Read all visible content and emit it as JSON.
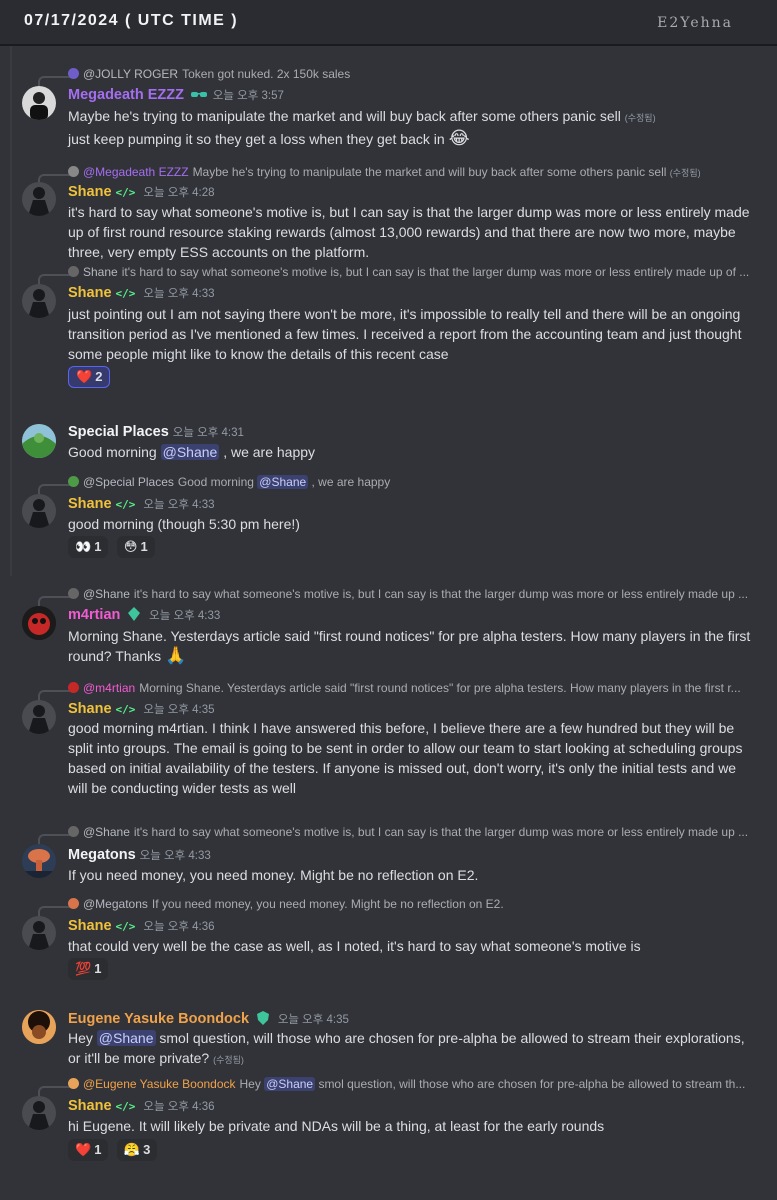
{
  "header": {
    "date": "07/17/2024 ( UTC TIME )",
    "brand": "E2Yehna"
  },
  "colors": {
    "megadeath": "#a46ef0",
    "shane": "#f0c23b",
    "special": "#f2f3f5",
    "m4rtian": "#f25bd2",
    "megatons": "#f2f3f5",
    "eugene": "#f0a24a"
  },
  "messages": [
    {
      "reply": {
        "name": "@JOLLY ROGER",
        "text": "Token got nuked. 2x 150k sales"
      },
      "author": "Megadeath EZZZ",
      "time": "오늘 오후 3:57",
      "lines": [
        "Maybe he's trying to manipulate the market and will buy back after some others panic sell",
        "just keep pumping it so they get a loss when they get back in"
      ],
      "edited": "(수정됨)",
      "emoji": "😂"
    },
    {
      "reply": {
        "name": "@Megadeath EZZZ",
        "text": "Maybe he's trying to manipulate the market and will buy back after some others panic sell",
        "edited": "(수정됨)"
      },
      "author": "Shane",
      "tag": "</>",
      "time": "오늘 오후 4:28",
      "text": "it's hard to say what someone's motive is, but I can say is that the larger dump was more or less entirely made up of first round resource staking rewards (almost 13,000 rewards) and that there are now two more, maybe three, very empty ESS accounts on the platform."
    },
    {
      "reply": {
        "name": "Shane",
        "text": "it's hard to say what someone's motive is, but I can say is that the larger dump was more or less entirely made up of ..."
      },
      "author": "Shane",
      "tag": "</>",
      "time": "오늘 오후 4:33",
      "text": "just pointing out I am not saying there won't be more, it's impossible to really tell and there will be an ongoing transition period as I've mentioned a few times. I received a report from the accounting team and just thought some people might like to know the details of this recent case",
      "reactions": [
        {
          "emoji": "❤️",
          "count": "2"
        }
      ]
    },
    {
      "author": "Special Places",
      "time": "오늘 오후 4:31",
      "pre": "Good morning",
      "mention": "@Shane",
      "post": ", we are happy"
    },
    {
      "reply": {
        "name": "@Special Places",
        "text_pre": "Good morning",
        "mention": "@Shane",
        "text_post": ", we are happy"
      },
      "author": "Shane",
      "tag": "</>",
      "time": "오늘 오후 4:33",
      "text": "good morning (though 5:30 pm here!)",
      "reactions": [
        {
          "emoji": "👀",
          "count": "1"
        },
        {
          "emoji": "😳",
          "count": "1"
        }
      ]
    },
    {
      "reply": {
        "name": "@Shane",
        "text": "it's hard to say what someone's motive is, but I can say is that the larger dump was more or less entirely made up ..."
      },
      "author": "m4rtian",
      "time": "오늘 오후 4:33",
      "text": "Morning Shane. Yesterdays article said \"first round notices\" for pre alpha testers. How many players in the first round? Thanks",
      "emoji": "🙏"
    },
    {
      "reply": {
        "name": "@m4rtian",
        "text": "Morning Shane. Yesterdays article said \"first round notices\" for pre alpha testers. How many players in the first r..."
      },
      "author": "Shane",
      "tag": "</>",
      "time": "오늘 오후 4:35",
      "text": "good morning m4rtian. I think I have answered this before, I believe there are a few hundred but they will be split into groups. The email is going to be sent in order to allow our team to start looking at scheduling groups based on initial availability of the testers. If anyone is missed out, don't worry, it's only the initial tests and we will be conducting wider tests as well"
    },
    {
      "reply": {
        "name": "@Shane",
        "text": "it's hard to say what someone's motive is, but I can say is that the larger dump was more or less entirely made up ..."
      },
      "author": "Megatons",
      "time": "오늘 오후 4:33",
      "text": "If you need money, you need money. Might be no reflection on E2."
    },
    {
      "reply": {
        "name": "@Megatons",
        "text": "If you need money, you need money. Might be no reflection on E2."
      },
      "author": "Shane",
      "tag": "</>",
      "time": "오늘 오후 4:36",
      "text": "that could very well be the case as well, as I noted, it's hard to say what someone's motive is",
      "reactions": [
        {
          "emoji": "💯",
          "count": "1"
        }
      ]
    },
    {
      "author": "Eugene Yasuke Boondock",
      "time": "오늘 오후 4:35",
      "pre": "Hey",
      "mention": "@Shane",
      "post": "smol question, will those who are chosen for pre-alpha be allowed to stream their explorations,",
      "line2": "or it'll be more private?",
      "edited": "(수정됨)"
    },
    {
      "reply": {
        "name": "@Eugene Yasuke Boondock",
        "text_pre": "Hey",
        "mention": "@Shane",
        "text_post": "smol question, will those who are chosen for pre-alpha be allowed to stream th..."
      },
      "author": "Shane",
      "tag": "</>",
      "time": "오늘 오후 4:36",
      "text": "hi Eugene. It will likely be private and NDAs will be a thing, at least for the early rounds",
      "reactions": [
        {
          "emoji": "❤️",
          "count": "1"
        },
        {
          "emoji": "😤",
          "count": "3"
        }
      ]
    }
  ]
}
